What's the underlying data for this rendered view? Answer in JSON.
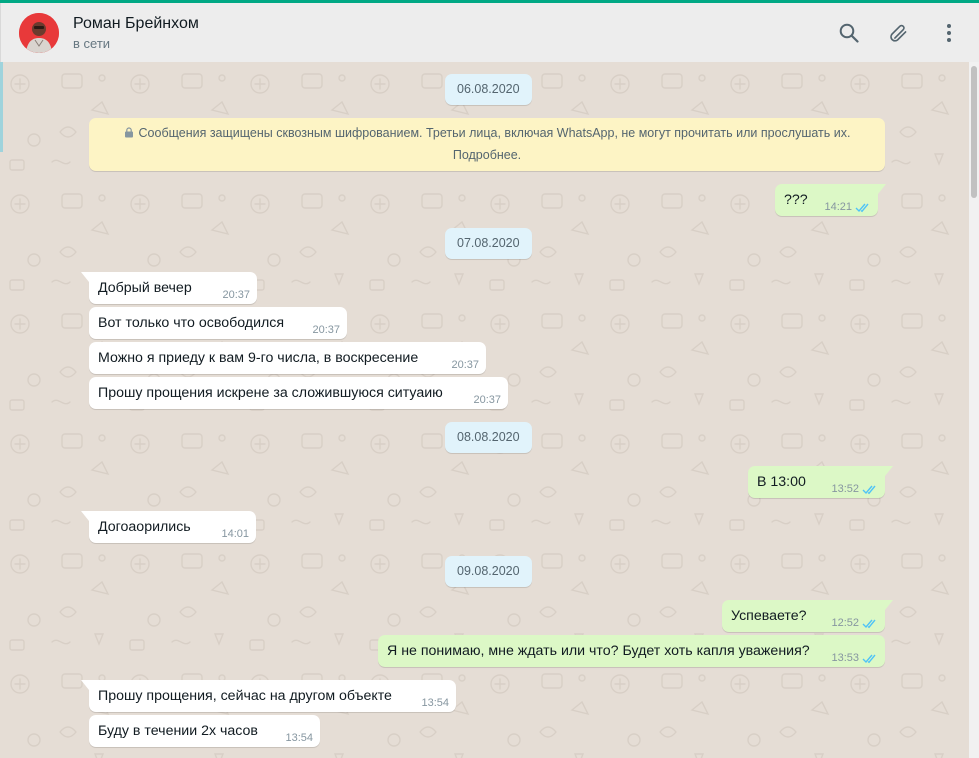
{
  "header": {
    "contact_name": "Роман Брейнхом",
    "status": "в сети",
    "actions": [
      "search-icon",
      "attach-icon",
      "menu-icon"
    ]
  },
  "colors": {
    "accent": "#00a884",
    "chat_bg": "#e5ddd5",
    "incoming": "#ffffff",
    "outgoing": "#dcf8c6",
    "date_chip": "#e1f3fb",
    "notice": "#fdf4c5",
    "read_ticks": "#4fc3f7"
  },
  "dates": [
    "06.08.2020",
    "07.08.2020",
    "08.08.2020",
    "09.08.2020"
  ],
  "notice": {
    "text": "Сообщения защищены сквозным шифрованием. Третьи лица, включая WhatsApp, не могут прочитать или прослушать их.",
    "link": "Подробнее."
  },
  "messages": [
    {
      "dir": "out",
      "text": "???",
      "time": "14:21",
      "status": "read"
    },
    {
      "dir": "in",
      "text": "Добрый вечер",
      "time": "20:37"
    },
    {
      "dir": "in",
      "text": "Вот только что освободился",
      "time": "20:37"
    },
    {
      "dir": "in",
      "text": "Можно я приеду к вам 9-го числа, в воскресение",
      "time": "20:37"
    },
    {
      "dir": "in",
      "text": "Прошу прощения искрене за сложившуюся ситуаию",
      "time": "20:37"
    },
    {
      "dir": "out",
      "text": "В 13:00",
      "time": "13:52",
      "status": "read"
    },
    {
      "dir": "in",
      "text": "Догоаорились",
      "time": "14:01"
    },
    {
      "dir": "out",
      "text": "Успеваете?",
      "time": "12:52",
      "status": "read"
    },
    {
      "dir": "out",
      "text": "Я не понимаю, мне ждать или что? Будет хоть капля уважения?",
      "time": "13:53",
      "status": "read"
    },
    {
      "dir": "in",
      "text": "Прошу прощения, сейчас на другом объекте",
      "time": "13:54"
    },
    {
      "dir": "in",
      "text": "Буду в течении 2х часов",
      "time": "13:54"
    }
  ]
}
